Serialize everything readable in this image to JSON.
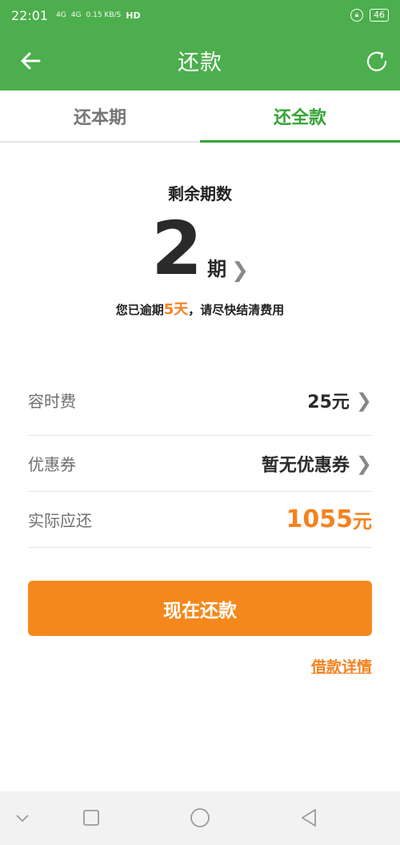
{
  "status_bar": {
    "time": "22:01",
    "signal1": "4G",
    "signal2": "4G",
    "speed": "0.15 KB/S",
    "hd": "HD",
    "battery": "46"
  },
  "header": {
    "title": "还款"
  },
  "tabs": [
    {
      "label": "还本期",
      "active": false
    },
    {
      "label": "还全款",
      "active": true
    }
  ],
  "summary": {
    "remaining_label": "剩余期数",
    "periods": "2",
    "period_unit": "期",
    "overdue_prefix": "您已逾期",
    "overdue_days": "5天",
    "overdue_suffix": "，请尽快结清费用"
  },
  "rows": {
    "fee_label": "容时费",
    "fee_value": "25元",
    "coupon_label": "优惠券",
    "coupon_value": "暂无优惠券",
    "total_label": "实际应还",
    "total_amount": "1055",
    "total_unit": "元"
  },
  "actions": {
    "pay_now": "现在还款",
    "loan_details": "借款详情"
  },
  "colors": {
    "primary_green": "#4cae4c",
    "accent_orange": "#f5881d"
  }
}
